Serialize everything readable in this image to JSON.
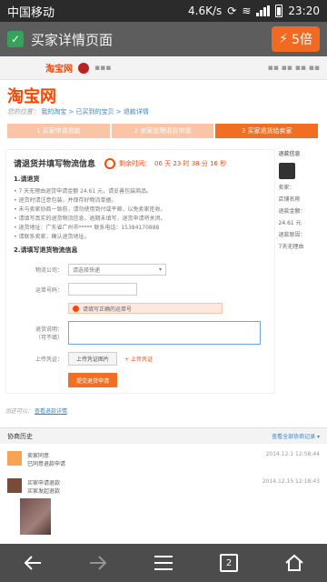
{
  "status": {
    "carrier": "中国移动",
    "speed": "4.6K/s",
    "time": "23:20"
  },
  "browser": {
    "page_title": "买家详情页面",
    "multiplier": "5倍"
  },
  "site": {
    "mini_logo": "淘宝网",
    "logo": "淘宝网",
    "crumbs_prefix": "您的位置：",
    "crumbs_link": "我的淘宝 > 已买到的宝贝 > 退款详情"
  },
  "steps": [
    {
      "label": "1 买家申请退款"
    },
    {
      "label": "2 卖家处理退货申请"
    },
    {
      "label": "3 买家退货给卖家"
    }
  ],
  "info": {
    "title": "请退货并填写物流信息",
    "countdown_prefix": "剩余时间：",
    "countdown_value": "06 天 23 时 38 分 16 秒",
    "section1": "1.请退货",
    "lines": [
      "• 7 天无理由退货申请金额 24.61 元，请妥善包装商品。",
      "• 退货时请注意包装，并保存好物流单据。",
      "• 未与卖家协商一致前，请勿使用到付或平邮，以免卖家拒收。",
      "• 请填写真实的退货物流信息，逾期未填写，退货申请将关闭。",
      "• 退货地址：广东省广州市***** 联系电话：15384170888",
      "• 请联系卖家，确认退货地址。"
    ],
    "section2": "2.请填写退货物流信息"
  },
  "form": {
    "company_label": "物流公司：",
    "company_value": "请选择快递",
    "tracking_label": "运单号码：",
    "warn_text": "请填写正确的运单号",
    "desc_label": "退货说明：",
    "desc_hint": "（可不填）",
    "upload_label": "上传凭证：",
    "upload_button": "上传凭证图片",
    "upload_hint": "+ 上传凭证",
    "submit": "提交退货申请"
  },
  "back": {
    "prefix": "您还可以：",
    "link": "查看退款详情"
  },
  "history": {
    "title": "协商历史",
    "more": "查看全部协商记录 ▾",
    "items": [
      {
        "name": "卖家同意",
        "text": "已同意退款申请",
        "time": "2014.12.1 12:58:44"
      },
      {
        "name": "买家申请退款",
        "text": "买家发起退款",
        "time": "2014.12.15 12:18:43"
      }
    ]
  },
  "side": {
    "title": "退款信息",
    "lines": [
      "卖家：",
      "店铺名称",
      "退款金额：",
      "24.61 元",
      "退款原因：",
      "7天无理由"
    ]
  }
}
